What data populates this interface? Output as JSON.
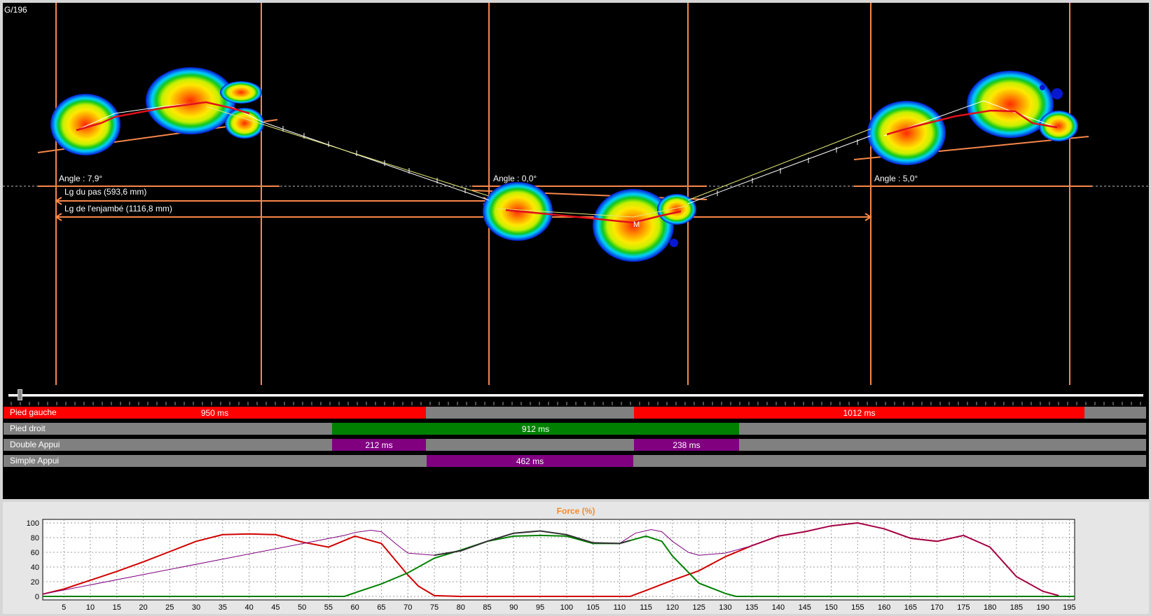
{
  "viewport": {
    "frame_counter": "G/196",
    "angles": [
      "Angle : 7,9°",
      "Angle : 0,0°",
      "Angle : 5,0°"
    ],
    "step_length": "Lg du pas (593,6 mm)",
    "stride_length": "Lg de l'enjambé (1116,8 mm)"
  },
  "phases": {
    "rows": [
      {
        "label": "Pied gauche",
        "segments": [
          {
            "text": "950 ms",
            "color": "#ff0000"
          },
          {
            "text": "1012 ms",
            "color": "#ff0000"
          }
        ]
      },
      {
        "label": "Pied droit",
        "segments": [
          {
            "text": "912 ms",
            "color": "#008000"
          }
        ]
      },
      {
        "label": "Double Appui",
        "segments": [
          {
            "text": "212 ms",
            "color": "#800080"
          },
          {
            "text": "238 ms",
            "color": "#800080"
          }
        ]
      },
      {
        "label": "Simple Appui",
        "segments": [
          {
            "text": "462 ms",
            "color": "#800080"
          }
        ]
      }
    ],
    "background_color": "#808080"
  },
  "chart_data": {
    "type": "line",
    "title": "Force (%)",
    "xlim": [
      1,
      196
    ],
    "ylim": [
      0,
      100
    ],
    "xticks": [
      5,
      10,
      15,
      20,
      25,
      30,
      35,
      40,
      45,
      50,
      55,
      60,
      65,
      70,
      75,
      80,
      85,
      90,
      95,
      100,
      105,
      110,
      115,
      120,
      125,
      130,
      135,
      140,
      145,
      150,
      155,
      160,
      165,
      170,
      175,
      180,
      185,
      190,
      195
    ],
    "yticks": [
      0,
      20,
      40,
      60,
      80,
      100
    ],
    "grid": true,
    "series": [
      {
        "color": "#d00000",
        "x": [
          1,
          5,
          10,
          15,
          20,
          25,
          30,
          35,
          40,
          45,
          50,
          55,
          60,
          65,
          70,
          72,
          75,
          80,
          100,
          112,
          115,
          120,
          125,
          130,
          135,
          140,
          145,
          150,
          155,
          160,
          165,
          170,
          175,
          180,
          185,
          190,
          193
        ],
        "y": [
          3,
          10,
          22,
          34,
          47,
          61,
          75,
          84,
          85,
          84,
          74,
          67,
          82,
          72,
          29,
          14,
          1,
          0,
          0,
          0,
          8,
          22,
          35,
          54,
          69,
          82,
          88,
          96,
          100,
          92,
          79,
          75,
          83,
          67,
          27,
          7,
          1
        ]
      },
      {
        "color": "#008000",
        "x": [
          1,
          58,
          60,
          65,
          70,
          75,
          80,
          85,
          90,
          95,
          100,
          105,
          110,
          112,
          115,
          118,
          120,
          125,
          130,
          132,
          196
        ],
        "y": [
          0,
          0,
          5,
          17,
          32,
          52,
          63,
          75,
          82,
          83,
          82,
          72,
          72,
          76,
          82,
          75,
          55,
          18,
          4,
          0,
          0
        ]
      },
      {
        "color": "#800080",
        "x": [
          1,
          58,
          60,
          63,
          65,
          68,
          70,
          75,
          80,
          85,
          90,
          95,
          100,
          105,
          110,
          113,
          116,
          118,
          120,
          123,
          125,
          130,
          135,
          140,
          145,
          150,
          155,
          160,
          165,
          170,
          175,
          180,
          185,
          190,
          193
        ],
        "y": [
          3,
          83,
          87,
          90,
          88,
          70,
          59,
          56,
          62,
          75,
          86,
          89,
          84,
          73,
          72,
          86,
          91,
          88,
          75,
          60,
          56,
          59,
          69,
          82,
          88,
          96,
          100,
          92,
          79,
          75,
          83,
          67,
          27,
          7,
          1
        ]
      },
      {
        "color": "#303030",
        "x": [
          75,
          80,
          85,
          90,
          95,
          100,
          105,
          110,
          112
        ],
        "y": [
          56,
          62,
          75,
          86,
          89,
          84,
          73,
          72,
          76
        ]
      }
    ]
  }
}
